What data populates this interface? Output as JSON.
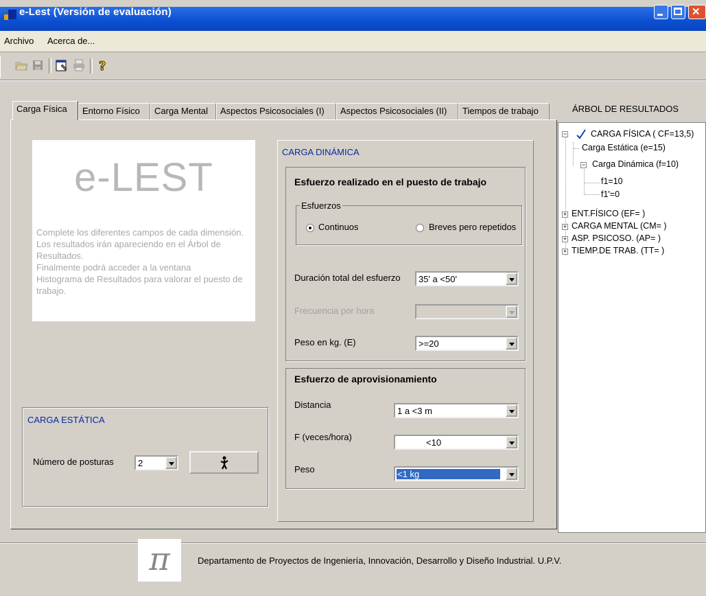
{
  "window": {
    "title": "e-Lest  (Versión de evaluación)"
  },
  "menu": {
    "items": [
      "Archivo",
      "Acerca de..."
    ]
  },
  "toolbar": {
    "icons": [
      "open-folder-icon",
      "save-icon",
      "properties-icon",
      "print-icon",
      "help-icon"
    ]
  },
  "tabs": [
    {
      "label": "Carga Física",
      "active": true
    },
    {
      "label": "Entorno Físico"
    },
    {
      "label": "Carga Mental"
    },
    {
      "label": "Aspectos Psicosociales (I)"
    },
    {
      "label": "Aspectos Psicosociales (II)"
    },
    {
      "label": "Tiempos de trabajo"
    }
  ],
  "info": {
    "logo": "e-LEST",
    "lines": [
      "Complete los diferentes campos de cada dimensión.",
      "Los resultados irán apareciendo en el Árbol de",
      "Resultados.",
      "Finalmente podrá acceder a la ventana",
      "Histograma de Resultados para valorar el puesto de",
      "trabajo."
    ]
  },
  "static_load": {
    "title": "CARGA ESTÁTICA",
    "postures_label": "Número de posturas",
    "postures_value": "2",
    "postures_button_icon": "posture-figure-icon"
  },
  "dynamic_load": {
    "title": "CARGA DINÁMICA",
    "effort_heading": "Esfuerzo realizado en el puesto de trabajo",
    "efforts_legend": "Esfuerzos",
    "radio_continuous": "Continuos",
    "radio_brief": "Breves pero repetidos",
    "selected_radio": "Continuos",
    "duration_label": "Duración total del esfuerzo",
    "duration_value": "35' a <50'",
    "frequency_label": "Frecuencia por hora",
    "frequency_value": "",
    "weight_label": "Peso en kg. (E)",
    "weight_value": ">=20",
    "supply_heading": "Esfuerzo de aprovisionamiento",
    "distance_label": "Distancia",
    "distance_value": "1 a <3 m",
    "f_label": "F (veces/hora)",
    "f_value": "<10",
    "peso_label": "Peso",
    "peso_value": "<1 kg"
  },
  "results_tree": {
    "title": "ÁRBOL DE RESULTADOS",
    "root": "CARGA FÍSICA ( CF=13,5)",
    "static": "Carga Estática (e=15)",
    "dynamic": "Carga Dinámica (f=10)",
    "f1": "f1=10",
    "f1p": "f1'=0",
    "ent": "ENT.FÍSICO (EF=   )",
    "mental": "CARGA MENTAL (CM=  )",
    "psico": "ASP. PSICOSO. (AP=  )",
    "tiemp": "TIEMP.DE TRAB. (TT=  )",
    "check_color": "#1a3fb0"
  },
  "footer": {
    "logo": "π",
    "text": "Departamento de Proyectos de Ingeniería, Innovación, Desarrollo y Diseño Industrial. U.P.V."
  }
}
